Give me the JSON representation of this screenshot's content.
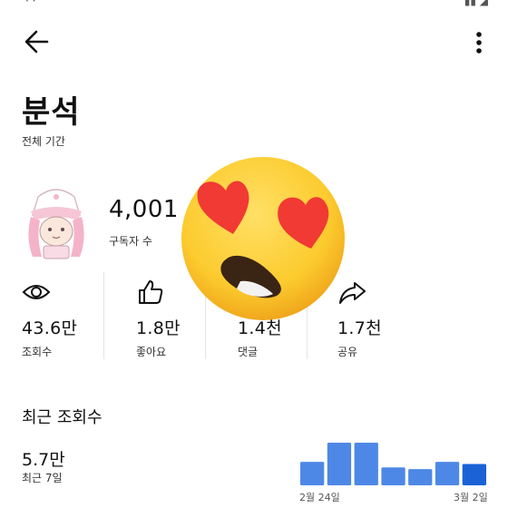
{
  "header": {
    "back_icon": "arrow-left-icon",
    "more_icon": "more-vertical-icon"
  },
  "page": {
    "title": "분석",
    "period": "전체 기간"
  },
  "channel": {
    "subscribers": "4,001",
    "subscribers_label": "구독자 수"
  },
  "metrics": [
    {
      "icon": "eye-icon",
      "value": "43.6만",
      "label": "조회수"
    },
    {
      "icon": "thumbs-up-icon",
      "value": "1.8만",
      "label": "좋아요"
    },
    {
      "icon": "comment-icon",
      "value": "1.4천",
      "label": "댓글"
    },
    {
      "icon": "share-icon",
      "value": "1.7천",
      "label": "공유"
    }
  ],
  "recent": {
    "title": "최근 조회수",
    "value": "5.7만",
    "label": "최근 7일",
    "x_start_label": "2월 24일",
    "x_end_label": "3월 2일"
  },
  "colors": {
    "bar": "#4e88e6",
    "bar_last": "#1a62d6",
    "divider": "#e4e4e4"
  },
  "chart_data": {
    "type": "bar",
    "categories": [
      "2월 24일",
      "",
      "",
      "",
      "",
      "",
      "3월 2일"
    ],
    "values": [
      0.55,
      1.0,
      1.0,
      0.42,
      0.38,
      0.55,
      0.5
    ],
    "title": "",
    "xlabel": "",
    "ylabel": ""
  }
}
